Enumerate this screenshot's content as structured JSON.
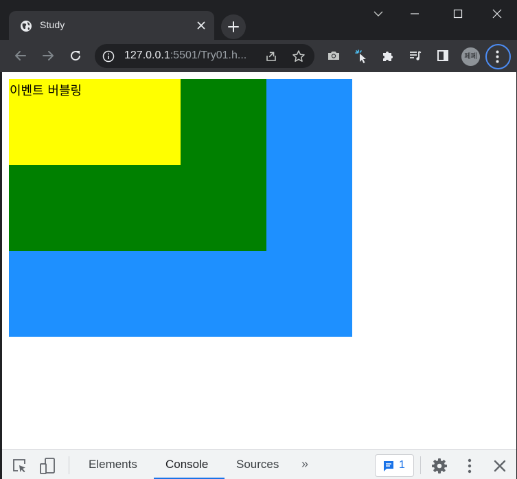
{
  "browser": {
    "tab": {
      "title": "Study"
    },
    "window_controls": [
      "chevron-down",
      "minimize",
      "maximize",
      "close"
    ],
    "address": {
      "host": "127.0.0.1",
      "rest": ":5501/Try01.h..."
    },
    "profile_initial": "페페"
  },
  "page": {
    "inner_text": "이벤트 버블링",
    "colors": {
      "outer": "#1e90ff",
      "middle": "#008000",
      "inner": "#ffff00"
    }
  },
  "devtools": {
    "tabs": [
      "Elements",
      "Console",
      "Sources"
    ],
    "active_tab": "Console",
    "more": "»",
    "issues_count": "1"
  }
}
